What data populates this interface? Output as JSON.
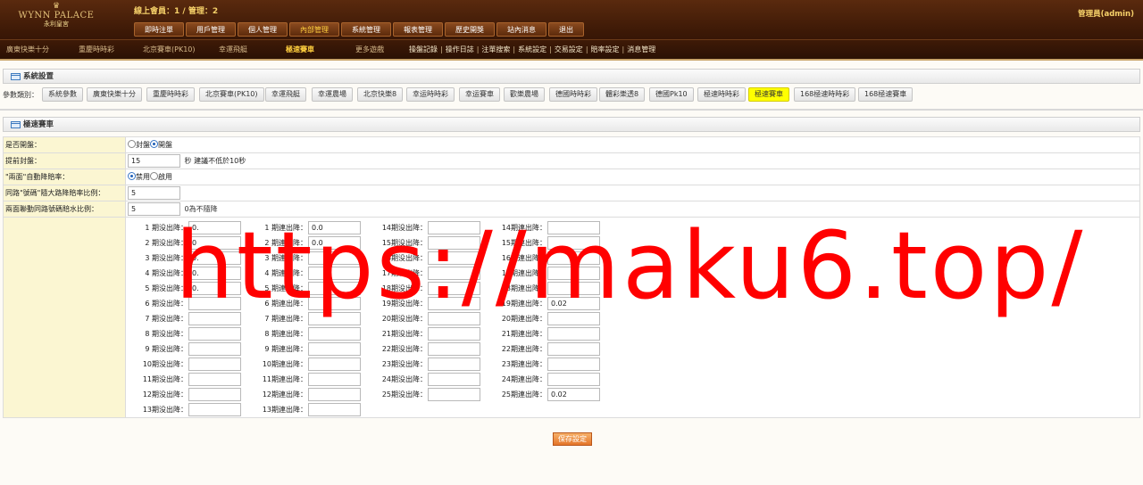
{
  "logo": {
    "name": "WYNN PALACE",
    "sub": "永利皇宮"
  },
  "header": {
    "online": "線上會員：1 / 管理：2",
    "admin": "管理員(admin)",
    "topnav": [
      "即時注單",
      "用戶管理",
      "個人管理",
      "內部管理",
      "系統管理",
      "報表管理",
      "歷史開獎",
      "站內消息",
      "退出"
    ],
    "active_top": "內部管理",
    "games": [
      "廣東快樂十分",
      "重慶時時彩",
      "北京賽車(PK10)",
      "幸運飛艇",
      "極速賽車",
      "更多遊戲"
    ],
    "active_game": "極速賽車",
    "subnav": [
      "操盤記錄",
      "操作日誌",
      "注單搜索",
      "系統設定",
      "交易設定",
      "賠率設定",
      "消息管理"
    ]
  },
  "settings": {
    "title": "系統設置",
    "cat_label": "參數類別：",
    "categories": [
      "系統參數",
      "廣東快樂十分",
      "重慶時時彩",
      "北京賽車(PK10)",
      "幸運飛艇",
      "幸運農場",
      "北京快樂8",
      "幸运時時彩",
      "幸运賽車",
      "歡樂農場",
      "德國時時彩",
      "體彩樂透8",
      "德國Pk10",
      "極速時時彩",
      "極速賽車",
      "168極速時時彩",
      "168極速賽車"
    ],
    "active_category": "極速賽車"
  },
  "race": {
    "title": "極速賽車",
    "rows": {
      "open": {
        "label": "是否開盤：",
        "opt1": "封盤",
        "opt2": "開盤",
        "selected": "開盤"
      },
      "advance": {
        "label": "提前封盤：",
        "value": "15",
        "unit": "秒",
        "hint": "建議不低於10秒"
      },
      "auto": {
        "label": "\"兩面\"自動降賠率：",
        "opt1": "禁用",
        "opt2": "啟用",
        "selected": "禁用"
      },
      "ratio": {
        "label": "同路\"號碼\"隨大路降賠率比例：",
        "value": "5"
      },
      "linkage": {
        "label": "兩面聯動同路號碼賠水比例：",
        "value": "5",
        "hint": "0為不隨降"
      }
    },
    "grid": {
      "col1": {
        "rows": [
          {
            "label": "1 期没出降：",
            "value": "0."
          },
          {
            "label": "2 期没出降：",
            "value": "0"
          },
          {
            "label": "3 期没出降：",
            "value": "0."
          },
          {
            "label": "4 期没出降：",
            "value": "0."
          },
          {
            "label": "5 期没出降：",
            "value": "0."
          },
          {
            "label": "6 期没出降：",
            "value": ""
          },
          {
            "label": "7 期没出降：",
            "value": ""
          },
          {
            "label": "8 期没出降：",
            "value": ""
          },
          {
            "label": "9 期没出降：",
            "value": ""
          },
          {
            "label": "10期没出降：",
            "value": ""
          },
          {
            "label": "11期没出降：",
            "value": ""
          },
          {
            "label": "12期没出降：",
            "value": ""
          },
          {
            "label": "13期没出降：",
            "value": ""
          }
        ]
      },
      "col2": {
        "rows": [
          {
            "label": "1 期連出降：",
            "value": "0.0"
          },
          {
            "label": "2 期連出降：",
            "value": "0.0"
          },
          {
            "label": "3 期連出降：",
            "value": ""
          },
          {
            "label": "4 期連出降：",
            "value": ""
          },
          {
            "label": "5 期連出降：",
            "value": ""
          },
          {
            "label": "6 期連出降：",
            "value": ""
          },
          {
            "label": "7 期連出降：",
            "value": ""
          },
          {
            "label": "8 期連出降：",
            "value": ""
          },
          {
            "label": "9 期連出降：",
            "value": ""
          },
          {
            "label": "10期連出降：",
            "value": ""
          },
          {
            "label": "11期連出降：",
            "value": ""
          },
          {
            "label": "12期連出降：",
            "value": ""
          },
          {
            "label": "13期連出降：",
            "value": ""
          }
        ]
      },
      "col3": {
        "rows": [
          {
            "label": "14期没出降：",
            "value": ""
          },
          {
            "label": "15期没出降：",
            "value": ""
          },
          {
            "label": "16期没出降：",
            "value": ""
          },
          {
            "label": "17期没出降：",
            "value": ""
          },
          {
            "label": "18期没出降：",
            "value": ""
          },
          {
            "label": "19期没出降：",
            "value": ""
          },
          {
            "label": "20期没出降：",
            "value": ""
          },
          {
            "label": "21期没出降：",
            "value": ""
          },
          {
            "label": "22期没出降：",
            "value": ""
          },
          {
            "label": "23期没出降：",
            "value": ""
          },
          {
            "label": "24期没出降：",
            "value": ""
          },
          {
            "label": "25期没出降：",
            "value": ""
          }
        ]
      },
      "col4": {
        "rows": [
          {
            "label": "14期連出降：",
            "value": ""
          },
          {
            "label": "15期連出降：",
            "value": ""
          },
          {
            "label": "16期連出降：",
            "value": ""
          },
          {
            "label": "17期連出降：",
            "value": ""
          },
          {
            "label": "18期連出降：",
            "value": ""
          },
          {
            "label": "19期連出降：",
            "value": "0.02"
          },
          {
            "label": "20期連出降：",
            "value": ""
          },
          {
            "label": "21期連出降：",
            "value": ""
          },
          {
            "label": "22期連出降：",
            "value": ""
          },
          {
            "label": "23期連出降：",
            "value": ""
          },
          {
            "label": "24期連出降：",
            "value": ""
          },
          {
            "label": "25期連出降：",
            "value": "0.02"
          }
        ]
      }
    },
    "save_label": "保存設定"
  },
  "watermark": "https://maku6.top/"
}
